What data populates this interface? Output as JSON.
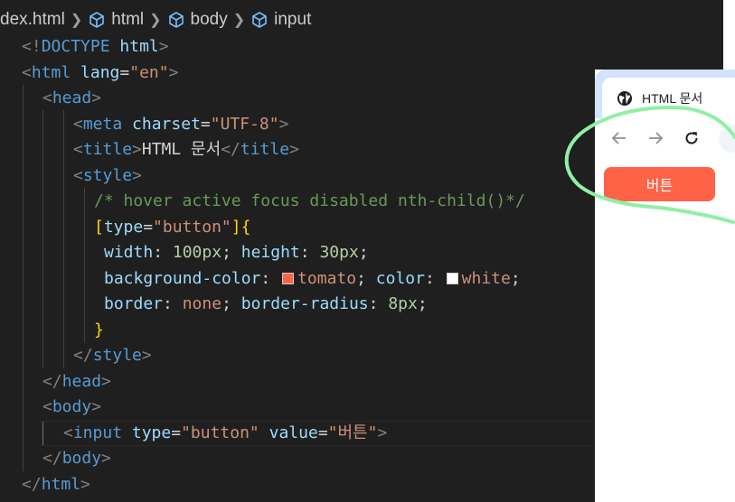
{
  "breadcrumb": {
    "file": "dex.html",
    "items": [
      "html",
      "body",
      "input"
    ]
  },
  "editor": {
    "lines": {
      "l1": {
        "open": "<!",
        "kw": "DOCTYPE",
        "val": "html",
        "close": ">"
      },
      "l2": {
        "open": "<",
        "tag": "html",
        "attr": "lang",
        "eq": "=",
        "val": "\"en\"",
        "close": ">"
      },
      "l3": {
        "open": "<",
        "tag": "head",
        "close": ">"
      },
      "l4": {
        "open": "<",
        "tag": "meta",
        "attr": "charset",
        "eq": "=",
        "val": "\"UTF-8\"",
        "close": ">"
      },
      "l5": {
        "open": "<",
        "tag": "title",
        "close": ">",
        "text": "HTML 문서",
        "open2": "</",
        "tag2": "title",
        "close2": ">"
      },
      "l6": {
        "open": "<",
        "tag": "style",
        "close": ">"
      },
      "l7": {
        "comment": "/* hover active focus disabled nth-child()*/"
      },
      "l8": {
        "lb": "[",
        "attr": "type",
        "eq": "=",
        "val": "\"button\"",
        "rb": "]",
        "brace": "{"
      },
      "l9": {
        "p1": "width",
        "c1": ": ",
        "v1": "100px",
        "s1": "; ",
        "p2": "height",
        "c2": ": ",
        "v2": "30px",
        "s2": ";"
      },
      "l10": {
        "p1": "background-color",
        "c1": ": ",
        "v1": "tomato",
        "s1": "; ",
        "p2": "color",
        "c2": ": ",
        "v2": "white",
        "s2": ";"
      },
      "l11": {
        "p1": "border",
        "c1": ": ",
        "v1": "none",
        "s1": "; ",
        "p2": "border-radius",
        "c2": ": ",
        "v2": "8px",
        "s2": ";"
      },
      "l12": {
        "brace": "}"
      },
      "l13": {
        "open": "</",
        "tag": "style",
        "close": ">"
      },
      "l14": {
        "open": "</",
        "tag": "head",
        "close": ">"
      },
      "l15": {
        "open": "<",
        "tag": "body",
        "close": ">"
      },
      "l16": {
        "open": "<",
        "tag": "input",
        "a1": "type",
        "eq1": "=",
        "v1": "\"button\"",
        "a2": "value",
        "eq2": "=",
        "v2": "\"버튼\"",
        "close": ">"
      },
      "l17": {
        "open": "</",
        "tag": "body",
        "close": ">"
      },
      "l18": {
        "open": "</",
        "tag": "html",
        "close": ">"
      }
    },
    "swatches": {
      "tomato": "#ff6347",
      "white": "#ffffff"
    }
  },
  "browser": {
    "tab_title": "HTML 문서",
    "tab_icon": "globe-icon",
    "toolbar_icons": [
      "back-arrow-icon",
      "forward-arrow-icon",
      "reload-icon"
    ],
    "button_value": "버튼",
    "button_bg": "#ff6347",
    "button_color": "#ffffff"
  },
  "annotation_color": "#8ff0a4"
}
